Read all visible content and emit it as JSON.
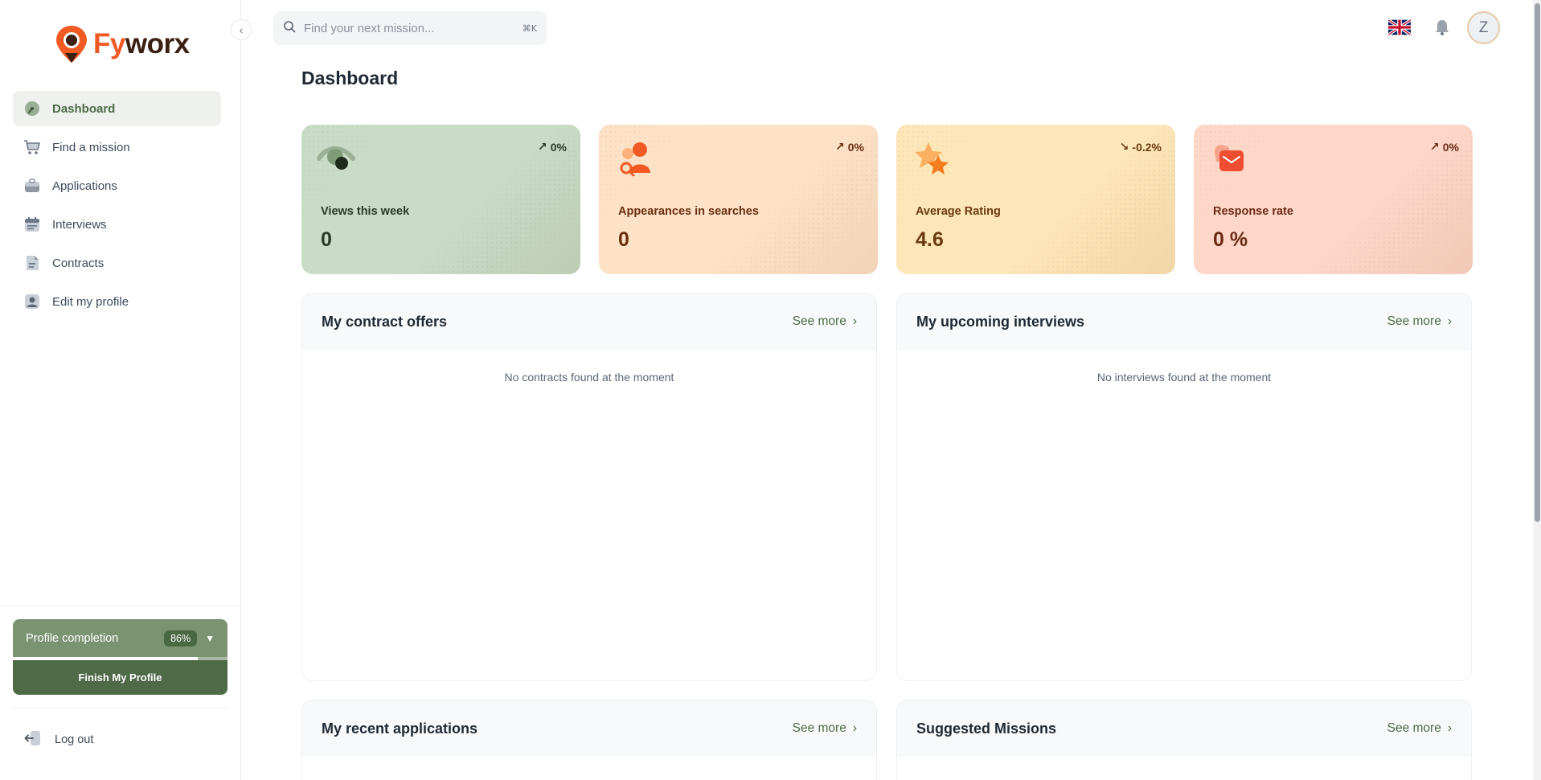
{
  "brand": {
    "name_part1": "Fy",
    "name_part2": "worx"
  },
  "sidebar": {
    "items": [
      {
        "label": "Dashboard",
        "icon": "dashboard-gauge-icon",
        "active": true
      },
      {
        "label": "Find a mission",
        "icon": "cart-icon",
        "active": false
      },
      {
        "label": "Applications",
        "icon": "briefcase-icon",
        "active": false
      },
      {
        "label": "Interviews",
        "icon": "calendar-icon",
        "active": false
      },
      {
        "label": "Contracts",
        "icon": "document-icon",
        "active": false
      },
      {
        "label": "Edit my profile",
        "icon": "user-card-icon",
        "active": false
      }
    ],
    "profile_completion": {
      "label": "Profile completion",
      "percent": "86%",
      "progress": 0.86,
      "button": "Finish My Profile"
    },
    "logout": "Log out"
  },
  "header": {
    "search_placeholder": "Find your next mission...",
    "search_shortcut": "⌘K",
    "language_icon": "uk-flag-icon",
    "avatar_letter": "Z"
  },
  "page": {
    "title": "Dashboard"
  },
  "stats": [
    {
      "label": "Views this week",
      "value": "0",
      "trend": "0%",
      "trend_dir": "up",
      "bg": "#c9dcc6",
      "accent": "#4a6b45",
      "text": "#2a3b26"
    },
    {
      "label": "Appearances in searches",
      "value": "0",
      "trend": "0%",
      "trend_dir": "up",
      "bg": "#fde2c8",
      "accent": "#f15a22",
      "text": "#6b2f10"
    },
    {
      "label": "Average Rating",
      "value": "4.6",
      "trend": "-0.2%",
      "trend_dir": "down",
      "bg": "#fde6b8",
      "accent": "#f38b1f",
      "text": "#6b3a10"
    },
    {
      "label": "Response rate",
      "value": "0 %",
      "trend": "0%",
      "trend_dir": "up",
      "bg": "#fdd8c8",
      "accent": "#ef4e33",
      "text": "#6b2a16"
    }
  ],
  "panels": {
    "contract_offers": {
      "title": "My contract offers",
      "see_more": "See more",
      "empty": "No contracts found at the moment"
    },
    "upcoming_interviews": {
      "title": "My upcoming interviews",
      "see_more": "See more",
      "empty": "No interviews found at the moment"
    },
    "recent_applications": {
      "title": "My recent applications",
      "see_more": "See more"
    },
    "suggested_missions": {
      "title": "Suggested Missions",
      "see_more": "See more"
    }
  }
}
